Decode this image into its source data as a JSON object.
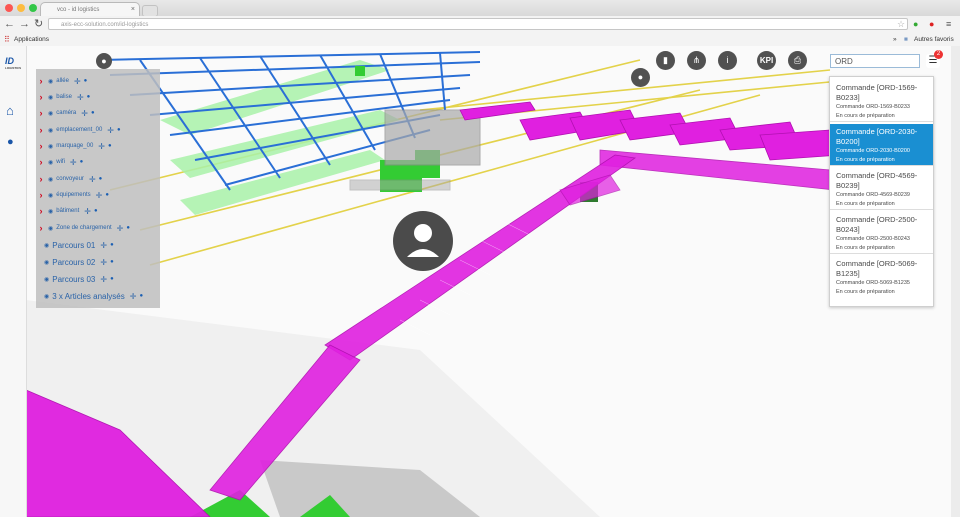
{
  "browser": {
    "tab_title": "vco - id logistics",
    "address": "axis-ecc-solution.com/id-logistics",
    "bookmarks_apps": "Applications",
    "bookmarks_overflow": "»",
    "bookmarks_other": "Autres favoris"
  },
  "logo": {
    "text": "ID",
    "subtext": "LOGISTICS"
  },
  "layers": [
    {
      "label": "allée",
      "chevron": true
    },
    {
      "label": "balise",
      "chevron": true
    },
    {
      "label": "caméra",
      "chevron": true
    },
    {
      "label": "emplacement_00",
      "chevron": true
    },
    {
      "label": "marquage_00",
      "chevron": true
    },
    {
      "label": "wifi",
      "chevron": true
    },
    {
      "label": "convoyeur",
      "chevron": true
    },
    {
      "label": "équipements",
      "chevron": true
    },
    {
      "label": "bâtiment",
      "chevron": true
    },
    {
      "label": "Zone de chargement",
      "chevron": true
    }
  ],
  "routes": [
    {
      "label": "Parcours 01"
    },
    {
      "label": "Parcours 02"
    },
    {
      "label": "Parcours 03"
    },
    {
      "label": "3 x Articles analysés"
    }
  ],
  "toolbar": {
    "kpi_label": "KPI"
  },
  "search": {
    "value": "ORD"
  },
  "notifications": {
    "count": "2"
  },
  "orders": [
    {
      "title": "Commande [ORD-1569-B0233]",
      "sub": "Commande ORD-1569-B0233",
      "status": "En cours de préparation",
      "selected": false
    },
    {
      "title": "Commande [ORD-2030-B0200]",
      "sub": "Commande ORD-2030-B0200",
      "status": "En cours de préparation",
      "selected": true
    },
    {
      "title": "Commande [ORD-4569-B0239]",
      "sub": "Commande ORD-4569-B0239",
      "status": "En cours de préparation",
      "selected": false
    },
    {
      "title": "Commande [ORD-2500-B0243]",
      "sub": "Commande ORD-2500-B0243",
      "status": "En cours de préparation",
      "selected": false
    },
    {
      "title": "Commande [ORD-5069-B1235]",
      "sub": "Commande ORD-5069-B1235",
      "status": "En cours de préparation",
      "selected": false
    }
  ],
  "colors": {
    "accent": "#1a8fd2",
    "conveyor": "#e020e0",
    "rack": "#2a6fd6",
    "equipment": "#33cc33"
  }
}
